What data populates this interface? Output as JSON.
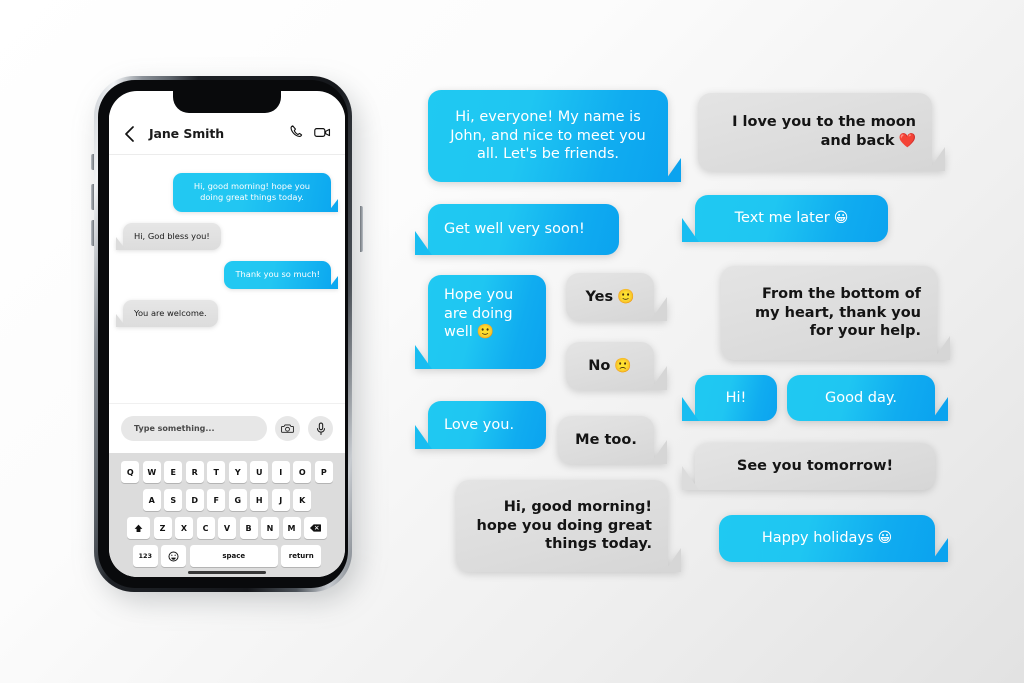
{
  "theme": {
    "blue_light": "#1FC9F2",
    "blue_dark": "#0BA3EF",
    "gray_bubble": "#DCDCDC",
    "text_dark": "#141414",
    "text_light": "#FFFFFF",
    "background": "#F2F2F2"
  },
  "phone": {
    "header": {
      "back_icon": "chevron-left-icon",
      "contact_name": "Jane Smith",
      "call_icon": "phone-icon",
      "video_icon": "video-camera-icon"
    },
    "messages": [
      {
        "side": "out",
        "text": "Hi, good morning! hope you doing great things today."
      },
      {
        "side": "in",
        "text": "Hi, God bless you!"
      },
      {
        "side": "out",
        "text": "Thank you so much!"
      },
      {
        "side": "in",
        "text": "You are welcome."
      }
    ],
    "input_bar": {
      "placeholder": "Type something...",
      "camera_icon": "camera-icon",
      "mic_icon": "microphone-icon"
    },
    "keyboard": {
      "row1": [
        "Q",
        "W",
        "E",
        "R",
        "T",
        "Y",
        "U",
        "I",
        "O",
        "P"
      ],
      "row2": [
        "A",
        "S",
        "D",
        "F",
        "G",
        "H",
        "J",
        "K"
      ],
      "row3": [
        "Z",
        "X",
        "C",
        "V",
        "B",
        "N",
        "M"
      ],
      "shift_label": "shift-icon",
      "backspace_label": "backspace-icon",
      "numbers_label": "123",
      "emoji_label": "emoji-icon",
      "space_label": "space",
      "return_label": "return"
    }
  },
  "gallery": {
    "bubbles": [
      {
        "id": "b1",
        "style": "blue",
        "text": "Hi, everyone! My name is John, and nice to meet you all. Let's be friends.",
        "emoji": ""
      },
      {
        "id": "b2",
        "style": "blue",
        "text": "Get well very soon!",
        "emoji": ""
      },
      {
        "id": "b3",
        "style": "blue",
        "text": "Hope you are doing well",
        "emoji": "🙂"
      },
      {
        "id": "b4",
        "style": "gray",
        "text": "Yes",
        "emoji": "🙂"
      },
      {
        "id": "b5",
        "style": "gray",
        "text": "No",
        "emoji": "🙁"
      },
      {
        "id": "b6",
        "style": "blue",
        "text": "Love you.",
        "emoji": ""
      },
      {
        "id": "b7",
        "style": "gray",
        "text": "Me too.",
        "emoji": ""
      },
      {
        "id": "b8",
        "style": "gray",
        "text": "Hi, good morning! hope you doing great things today.",
        "emoji": ""
      },
      {
        "id": "b9",
        "style": "gray",
        "text": "I love you to the moon and back",
        "emoji": "❤️"
      },
      {
        "id": "b10",
        "style": "blue",
        "text": "Text me later",
        "emoji": "😀"
      },
      {
        "id": "b11",
        "style": "gray",
        "text": "From the bottom of my heart, thank you for your help.",
        "emoji": ""
      },
      {
        "id": "b12",
        "style": "blue",
        "text": "Hi!",
        "emoji": ""
      },
      {
        "id": "b13",
        "style": "blue",
        "text": "Good day.",
        "emoji": ""
      },
      {
        "id": "b14",
        "style": "gray",
        "text": "See you tomorrow!",
        "emoji": ""
      },
      {
        "id": "b15",
        "style": "blue",
        "text": "Happy holidays",
        "emoji": "😀"
      }
    ]
  }
}
